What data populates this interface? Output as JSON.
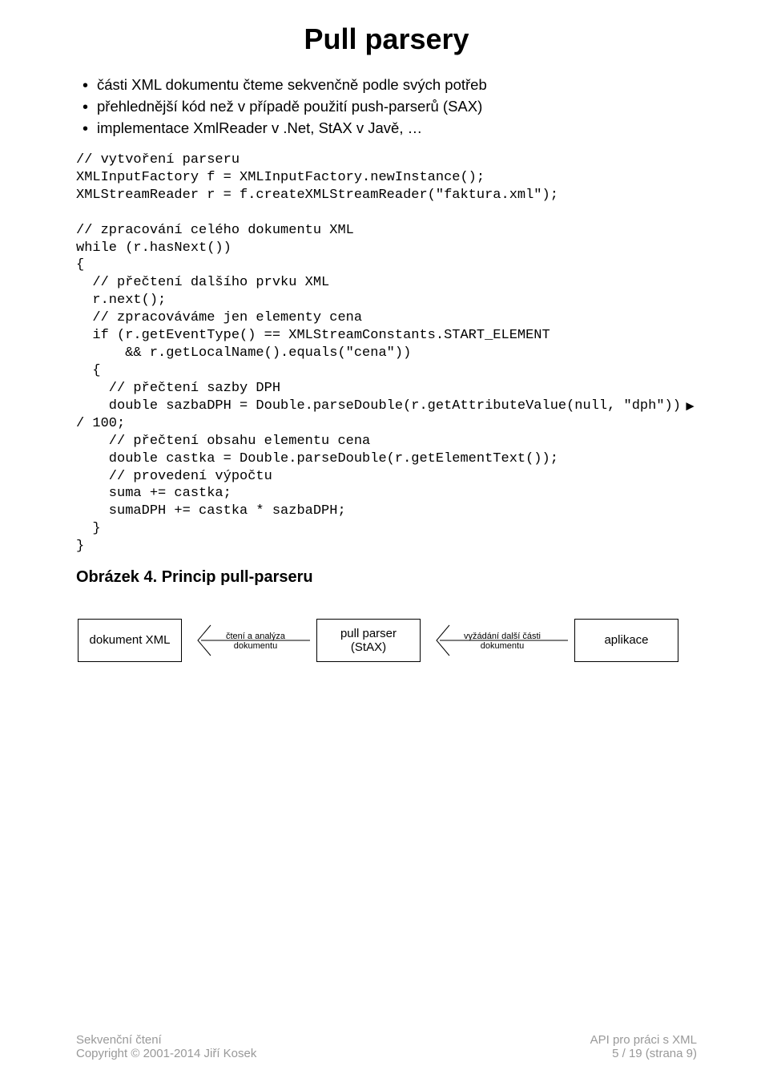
{
  "title": "Pull parsery",
  "bullets": [
    "části XML dokumentu čteme sekvenčně podle svých potřeb",
    "přehlednější kód než v případě použití push-parserů (SAX)",
    "implementace XmlReader v .Net, StAX v Javě, …"
  ],
  "code": {
    "l1": "// vytvoření parseru",
    "l2": "XMLInputFactory f = XMLInputFactory.newInstance();",
    "l3": "XMLStreamReader r = f.createXMLStreamReader(\"faktura.xml\");",
    "l4": "",
    "l5": "// zpracování celého dokumentu XML",
    "l6": "while (r.hasNext())",
    "l7": "{",
    "l8": "  // přečtení dalšího prvku XML",
    "l9": "  r.next();",
    "l10": "  // zpracováváme jen elementy cena",
    "l11": "  if (r.getEventType() == XMLStreamConstants.START_ELEMENT",
    "l12": "      && r.getLocalName().equals(\"cena\"))",
    "l13": "  {",
    "l14": "    // přečtení sazby DPH",
    "l15a": "    double sazbaDPH = Double.parseDouble(r.getAttributeValue(null, \"dph\"))",
    "l15cont": "►",
    "l16": "/ 100;",
    "l17": "    // přečtení obsahu elementu cena",
    "l18": "    double castka = Double.parseDouble(r.getElementText());",
    "l19": "    // provedení výpočtu",
    "l20": "    suma += castka;",
    "l21": "    sumaDPH += castka * sazbaDPH;",
    "l22": "  }",
    "l23": "}"
  },
  "figure_title": "Obrázek 4. Princip pull-parseru",
  "diagram": {
    "box1": "dokument XML",
    "arrow1_l1": "čtení a analýza",
    "arrow1_l2": "dokumentu",
    "box2_l1": "pull parser",
    "box2_l2": "(StAX)",
    "arrow2_l1": "vyžádání další části",
    "arrow2_l2": "dokumentu",
    "box3": "aplikace"
  },
  "footer": {
    "left_l1": "Sekvenční čtení",
    "left_l2": "Copyright © 2001-2014 Jiří Kosek",
    "right_l1": "API pro práci s XML",
    "right_l2": "5 / 19 (strana 9)"
  }
}
